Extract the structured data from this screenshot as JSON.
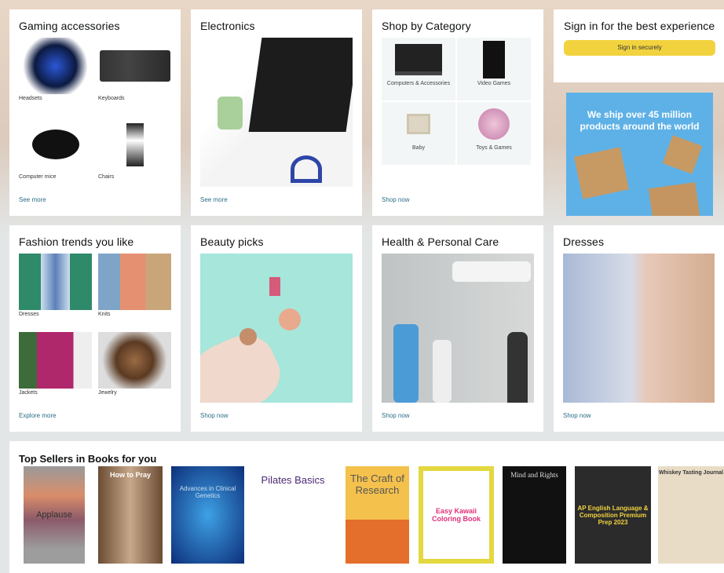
{
  "cards": {
    "gaming": {
      "title": "Gaming accessories",
      "items": [
        "Headsets",
        "Keyboards",
        "Computer mice",
        "Chairs"
      ],
      "link": "See more"
    },
    "electronics": {
      "title": "Electronics",
      "link": "See more"
    },
    "shop_by_category": {
      "title": "Shop by Category",
      "items": [
        "Computers & Accessories",
        "Video Games",
        "Baby",
        "Toys & Games"
      ],
      "link": "Shop now"
    },
    "signin": {
      "title": "Sign in for the best experience",
      "button": "Sign in securely"
    },
    "ad": {
      "text": "We ship over 45 million products around the world"
    },
    "fashion": {
      "title": "Fashion trends you like",
      "items": [
        "Dresses",
        "Knits",
        "Jackets",
        "Jewelry"
      ],
      "link": "Explore more"
    },
    "beauty": {
      "title": "Beauty picks",
      "link": "Shop now"
    },
    "health": {
      "title": "Health & Personal Care",
      "link": "Shop now"
    },
    "dresses": {
      "title": "Dresses",
      "link": "Shop now"
    }
  },
  "books": {
    "title": "Top Sellers in Books for you",
    "items": [
      "Applause",
      "How to Pray",
      "Advances in Clinical Genetics",
      "Pilates Basics",
      "The Craft of Research",
      "Easy Kawaii Coloring Book",
      "Mind and Rights",
      "AP English Language & Composition Premium Prep 2023",
      "Whiskey Tasting Journal"
    ]
  },
  "colors": {
    "accent_button": "#f2d33f",
    "link": "#2a6e86",
    "ad_bg": "#5eb1e6"
  }
}
